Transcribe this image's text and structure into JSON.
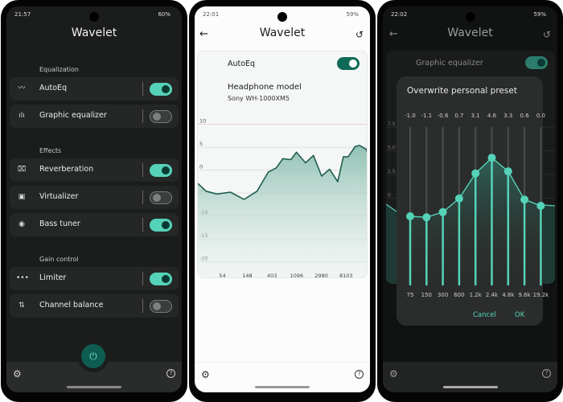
{
  "app_title": "Wavelet",
  "screen1": {
    "status": {
      "time": "21:57",
      "battery": "60%"
    },
    "sections": [
      {
        "label": "Equalization",
        "items": [
          {
            "label": "AutoEq",
            "icon": "trend-line-icon",
            "on": true
          },
          {
            "label": "Graphic equalizer",
            "icon": "waveform-icon",
            "on": false
          }
        ]
      },
      {
        "label": "Effects",
        "items": [
          {
            "label": "Reverberation",
            "icon": "reverb-icon",
            "on": true
          },
          {
            "label": "Virtualizer",
            "icon": "surround-icon",
            "on": false
          },
          {
            "label": "Bass tuner",
            "icon": "speaker-icon",
            "on": true
          }
        ]
      },
      {
        "label": "Gain control",
        "items": [
          {
            "label": "Limiter",
            "icon": "dots-line-icon",
            "on": true
          },
          {
            "label": "Channel balance",
            "icon": "balance-arrows-icon",
            "on": false
          }
        ]
      }
    ],
    "power_icon": "power-icon",
    "settings_icon": "gear-icon",
    "help_icon": "help-icon"
  },
  "screen2": {
    "status": {
      "time": "22:01",
      "battery": "59%"
    },
    "autoeq_label": "AutoEq",
    "autoeq_on": true,
    "headphone_label": "Headphone model",
    "headphone_value": "Sony WH-1000XM5"
  },
  "screen3": {
    "status": {
      "time": "22:02",
      "battery": "59%"
    },
    "graphic_eq_label": "Graphic equalizer",
    "graphic_eq_on": true,
    "dialog_title": "Overwrite personal preset",
    "cancel_label": "Cancel",
    "ok_label": "OK"
  },
  "colors": {
    "accent": "#55d3b9",
    "accent_dark": "#0f6b57",
    "dark_bg": "#1b1d1c",
    "light_bg": "#fbfcfb"
  },
  "chart_data": [
    {
      "type": "area",
      "x_scale": "log",
      "xlim": [
        20,
        20000
      ],
      "ylim": [
        -25,
        11
      ],
      "y_ticks": [
        10,
        5,
        0,
        -5,
        -10,
        -15,
        -20
      ],
      "x_ticks": [
        54,
        148,
        403,
        1096,
        2980,
        8103
      ],
      "grid": true,
      "x": [
        20,
        28,
        43,
        75,
        130,
        220,
        348,
        480,
        626,
        868,
        1085,
        1570,
        2160,
        3010,
        4160,
        5770,
        7250,
        8800,
        11800,
        14000,
        18200,
        20000
      ],
      "y": [
        -2.9,
        -4.6,
        -5.2,
        -4.8,
        -6.4,
        -4.6,
        -0.4,
        0.5,
        2.5,
        2.3,
        3.9,
        1.6,
        3.2,
        -1.3,
        0.2,
        -2.5,
        2.9,
        2.9,
        5.2,
        5.4,
        4.6,
        3.4
      ]
    },
    {
      "type": "line",
      "categories": [
        "75",
        "150",
        "300",
        "600",
        "1.2k",
        "2.4k",
        "4.8k",
        "9.6k",
        "19.2k"
      ],
      "values": [
        -1.0,
        -1.1,
        -0.6,
        0.7,
        3.1,
        4.6,
        3.3,
        0.6,
        0.0
      ],
      "value_labels": [
        "-1.0",
        "-1.1",
        "-0.6",
        "0.7",
        "3.1",
        "4.6",
        "3.3",
        "0.6",
        "0.0"
      ],
      "y_ticks": [
        "7.5",
        "5.0",
        "2.5",
        "0",
        "-2.5",
        "-5.0",
        "-7.5"
      ],
      "ylim": [
        -8,
        8
      ],
      "grid": true
    }
  ]
}
